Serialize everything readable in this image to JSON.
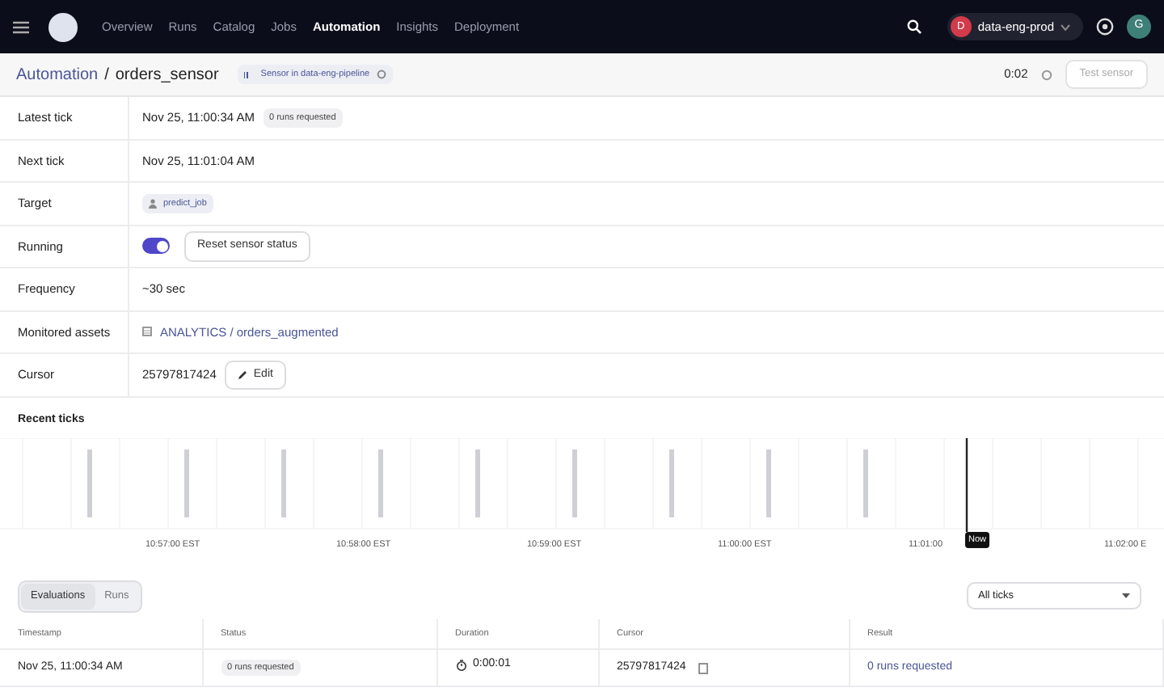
{
  "nav": {
    "items": [
      {
        "label": "Overview",
        "selected": false
      },
      {
        "label": "Runs",
        "selected": false
      },
      {
        "label": "Catalog",
        "selected": false
      },
      {
        "label": "Jobs",
        "selected": false
      },
      {
        "label": "Automation",
        "selected": true
      },
      {
        "label": "Insights",
        "selected": false
      },
      {
        "label": "Deployment",
        "selected": false
      }
    ],
    "deployment": {
      "initial": "D",
      "name": "data-eng-prod"
    },
    "user_initial": "G"
  },
  "header": {
    "breadcrumb": "Automation",
    "separator": "/",
    "title": "orders_sensor",
    "tag": "Sensor in data-eng-pipeline",
    "timer": "0:02",
    "test_button": "Test sensor"
  },
  "details": [
    {
      "label": "Latest tick",
      "kind": "text",
      "value": "Nov 25, 11:00:34 AM",
      "badge": "0 runs requested"
    },
    {
      "label": "Next tick",
      "kind": "text",
      "value": "Nov 25, 11:01:04 AM"
    },
    {
      "label": "Target",
      "kind": "job",
      "value": "predict_job"
    },
    {
      "label": "Running",
      "kind": "toggle",
      "on": true,
      "button": "Reset sensor status"
    },
    {
      "label": "Frequency",
      "kind": "text",
      "value": "~30 sec"
    },
    {
      "label": "Monitored assets",
      "kind": "asset",
      "value": "ANALYTICS / orders_augmented"
    },
    {
      "label": "Cursor",
      "kind": "edit",
      "value": "25797817424",
      "button": "Edit"
    }
  ],
  "recent_ticks": {
    "title": "Recent ticks",
    "axis_labels": [
      "10:57:00 EST",
      "10:58:00 EST",
      "10:59:00 EST",
      "11:00:00 EST",
      "11:01:00",
      "11:02:00 E"
    ],
    "now_label": "Now"
  },
  "tabs": [
    {
      "label": "Evaluations",
      "selected": true
    },
    {
      "label": "Runs",
      "selected": false
    }
  ],
  "filter": {
    "value": "All ticks"
  },
  "table": {
    "columns": [
      "Timestamp",
      "Status",
      "Duration",
      "Cursor",
      "Result"
    ],
    "rows": [
      {
        "timestamp": "Nov 25, 11:00:34 AM",
        "status": "0 runs requested",
        "duration": "0:00:01",
        "cursor": "25797817424",
        "result": "0 runs requested"
      }
    ]
  }
}
